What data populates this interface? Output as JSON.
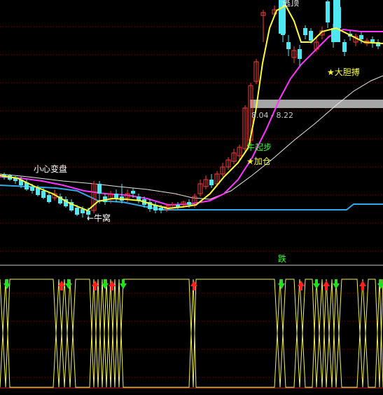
{
  "colors": {
    "background": "#000000",
    "grid": "#7a1010",
    "up_candle": "#ff3b3b",
    "down_candle": "#4fe7f2",
    "ma_yellow": "#ffff33",
    "ma_magenta": "#ff33ff",
    "ma_white": "#e8e8e8",
    "support_blue": "#33a8e6",
    "label_white": "#ffffff",
    "label_yellow": "#ffff33",
    "label_green": "#33ff33",
    "range_bar": "#a6a6a6",
    "divider": "#c8c8c8",
    "osc_yellow": "#f2f24d",
    "arrow_red": "#ff2020",
    "arrow_green": "#20e020"
  },
  "annotations": {
    "top_signal": "逃顶",
    "bold_buy": "★大胆搏",
    "price_range": "8.04 - 8.22",
    "bull_start": "牛起步",
    "add_position": "★加仓",
    "caution": "小心变盘",
    "bull_nest": "←牛窝",
    "indicator_title": "跌"
  }
}
